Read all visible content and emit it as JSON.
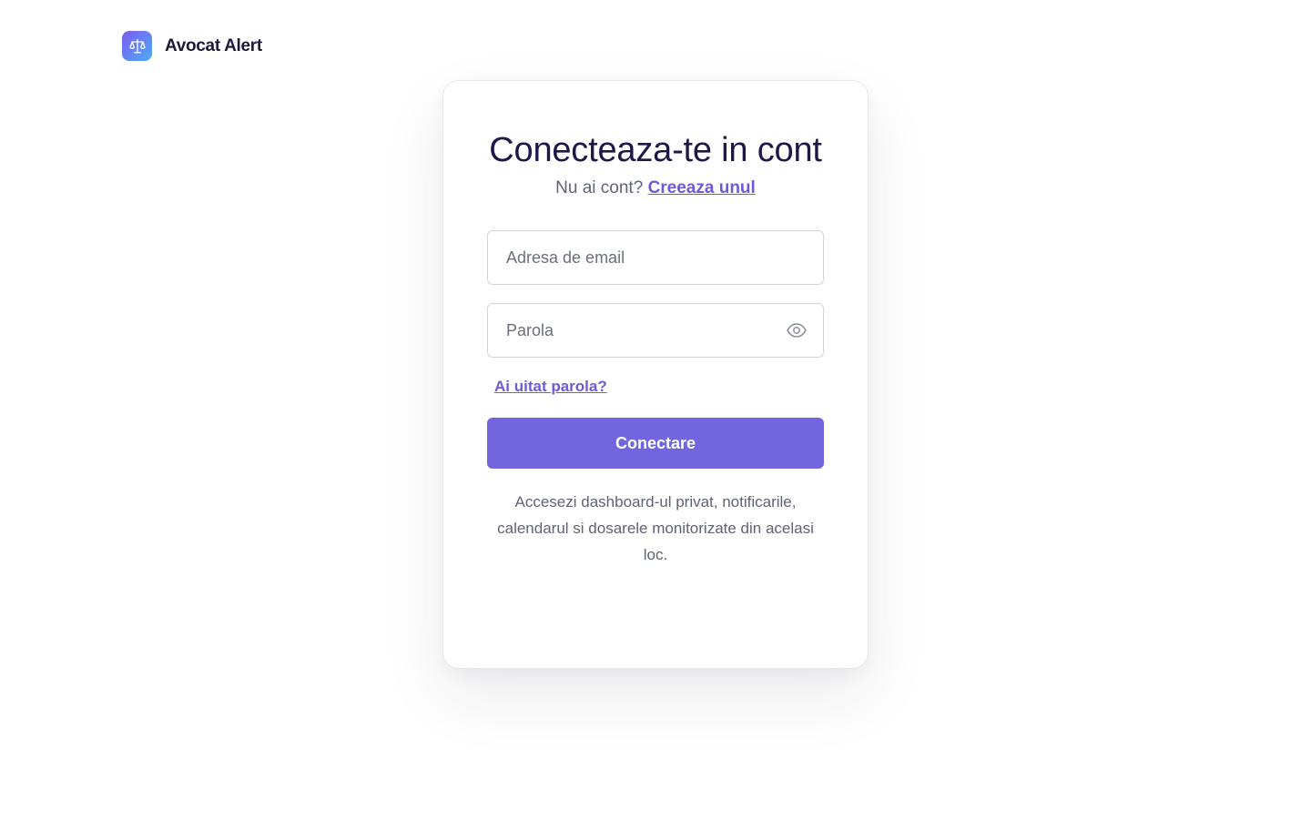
{
  "brand": {
    "name": "Avocat Alert",
    "logo_icon": "scales-icon",
    "logo_gradient": [
      "#7b5cf0",
      "#4fa9f5"
    ]
  },
  "login": {
    "title": "Conecteaza-te in cont",
    "subtitle_prefix": "Nu ai cont?",
    "create_account_link": "Creeaza unul",
    "email_placeholder": "Adresa de email",
    "email_value": "",
    "password_placeholder": "Parola",
    "password_value": "",
    "show_password_icon": "eye-icon",
    "forgot_password_link": "Ai uitat parola?",
    "submit_label": "Conectare",
    "note": "Accesezi dashboard-ul privat, notificarile, calendarul si dosarele monitorizate din acelasi loc."
  },
  "colors": {
    "accent": "#7265dd",
    "link": "#6d5bd8",
    "title": "#1f1745"
  }
}
